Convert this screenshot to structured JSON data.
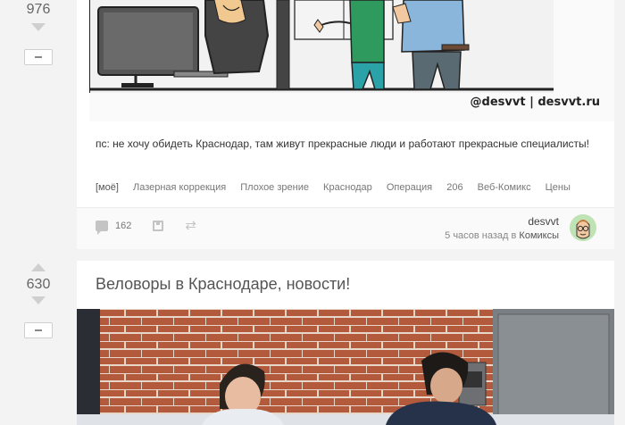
{
  "posts": [
    {
      "rating": "976",
      "comic_signature": "@desvvt | desvvt.ru",
      "text": "пс: не хочу обидеть Краснодар, там живут прекрасные люди и работают прекрасные специалисты!",
      "tags": [
        "[моё]",
        "Лазерная коррекция",
        "Плохое зрение",
        "Краснодар",
        "Операция",
        "206",
        "Веб-Комикс",
        "Цены"
      ],
      "comments_count": "162",
      "author": "desvvt",
      "time": "5 часов назад",
      "community_prefix": "в",
      "community": "Комиксы"
    },
    {
      "rating": "630",
      "title": "Веловоры в Краснодаре, новости!"
    }
  ],
  "icons": {
    "upvote": "arrow-up-icon",
    "downvote": "arrow-down-icon",
    "comments": "comment-icon",
    "save": "save-icon",
    "share": "share-icon"
  },
  "colors": {
    "background": "#f3f3f3",
    "card": "#ffffff",
    "muted": "#cfcfcf",
    "brick": "#b05a3a"
  }
}
